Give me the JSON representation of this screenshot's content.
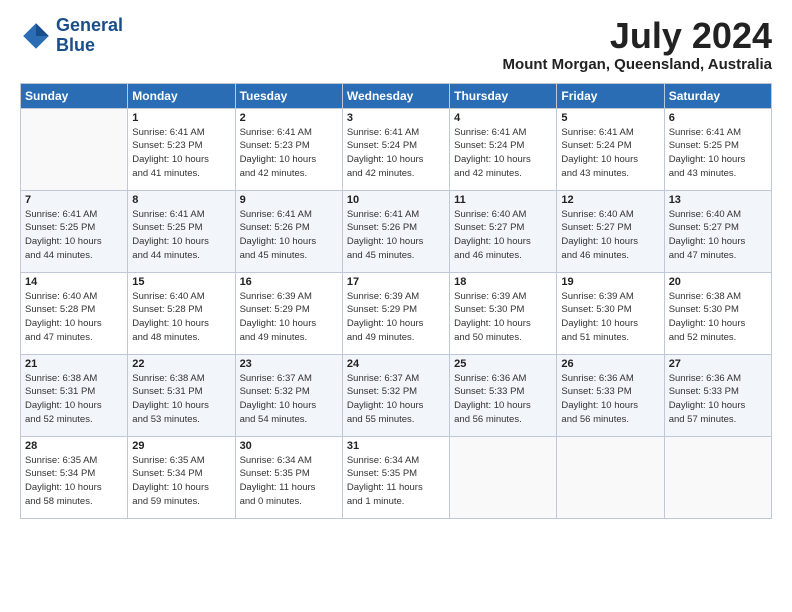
{
  "logo": {
    "line1": "General",
    "line2": "Blue"
  },
  "header": {
    "month_year": "July 2024",
    "location": "Mount Morgan, Queensland, Australia"
  },
  "days_of_week": [
    "Sunday",
    "Monday",
    "Tuesday",
    "Wednesday",
    "Thursday",
    "Friday",
    "Saturday"
  ],
  "weeks": [
    [
      {
        "day": "",
        "info": ""
      },
      {
        "day": "1",
        "info": "Sunrise: 6:41 AM\nSunset: 5:23 PM\nDaylight: 10 hours\nand 41 minutes."
      },
      {
        "day": "2",
        "info": "Sunrise: 6:41 AM\nSunset: 5:23 PM\nDaylight: 10 hours\nand 42 minutes."
      },
      {
        "day": "3",
        "info": "Sunrise: 6:41 AM\nSunset: 5:24 PM\nDaylight: 10 hours\nand 42 minutes."
      },
      {
        "day": "4",
        "info": "Sunrise: 6:41 AM\nSunset: 5:24 PM\nDaylight: 10 hours\nand 42 minutes."
      },
      {
        "day": "5",
        "info": "Sunrise: 6:41 AM\nSunset: 5:24 PM\nDaylight: 10 hours\nand 43 minutes."
      },
      {
        "day": "6",
        "info": "Sunrise: 6:41 AM\nSunset: 5:25 PM\nDaylight: 10 hours\nand 43 minutes."
      }
    ],
    [
      {
        "day": "7",
        "info": ""
      },
      {
        "day": "8",
        "info": "Sunrise: 6:41 AM\nSunset: 5:25 PM\nDaylight: 10 hours\nand 44 minutes."
      },
      {
        "day": "9",
        "info": "Sunrise: 6:41 AM\nSunset: 5:26 PM\nDaylight: 10 hours\nand 45 minutes."
      },
      {
        "day": "10",
        "info": "Sunrise: 6:41 AM\nSunset: 5:26 PM\nDaylight: 10 hours\nand 45 minutes."
      },
      {
        "day": "11",
        "info": "Sunrise: 6:40 AM\nSunset: 5:27 PM\nDaylight: 10 hours\nand 46 minutes."
      },
      {
        "day": "12",
        "info": "Sunrise: 6:40 AM\nSunset: 5:27 PM\nDaylight: 10 hours\nand 46 minutes."
      },
      {
        "day": "13",
        "info": "Sunrise: 6:40 AM\nSunset: 5:27 PM\nDaylight: 10 hours\nand 47 minutes."
      }
    ],
    [
      {
        "day": "14",
        "info": ""
      },
      {
        "day": "15",
        "info": "Sunrise: 6:40 AM\nSunset: 5:28 PM\nDaylight: 10 hours\nand 48 minutes."
      },
      {
        "day": "16",
        "info": "Sunrise: 6:39 AM\nSunset: 5:29 PM\nDaylight: 10 hours\nand 49 minutes."
      },
      {
        "day": "17",
        "info": "Sunrise: 6:39 AM\nSunset: 5:29 PM\nDaylight: 10 hours\nand 49 minutes."
      },
      {
        "day": "18",
        "info": "Sunrise: 6:39 AM\nSunset: 5:30 PM\nDaylight: 10 hours\nand 50 minutes."
      },
      {
        "day": "19",
        "info": "Sunrise: 6:39 AM\nSunset: 5:30 PM\nDaylight: 10 hours\nand 51 minutes."
      },
      {
        "day": "20",
        "info": "Sunrise: 6:38 AM\nSunset: 5:30 PM\nDaylight: 10 hours\nand 52 minutes."
      }
    ],
    [
      {
        "day": "21",
        "info": ""
      },
      {
        "day": "22",
        "info": "Sunrise: 6:38 AM\nSunset: 5:31 PM\nDaylight: 10 hours\nand 53 minutes."
      },
      {
        "day": "23",
        "info": "Sunrise: 6:37 AM\nSunset: 5:32 PM\nDaylight: 10 hours\nand 54 minutes."
      },
      {
        "day": "24",
        "info": "Sunrise: 6:37 AM\nSunset: 5:32 PM\nDaylight: 10 hours\nand 55 minutes."
      },
      {
        "day": "25",
        "info": "Sunrise: 6:36 AM\nSunset: 5:33 PM\nDaylight: 10 hours\nand 56 minutes."
      },
      {
        "day": "26",
        "info": "Sunrise: 6:36 AM\nSunset: 5:33 PM\nDaylight: 10 hours\nand 56 minutes."
      },
      {
        "day": "27",
        "info": "Sunrise: 6:36 AM\nSunset: 5:33 PM\nDaylight: 10 hours\nand 57 minutes."
      }
    ],
    [
      {
        "day": "28",
        "info": ""
      },
      {
        "day": "29",
        "info": "Sunrise: 6:35 AM\nSunset: 5:34 PM\nDaylight: 10 hours\nand 59 minutes."
      },
      {
        "day": "30",
        "info": "Sunrise: 6:34 AM\nSunset: 5:35 PM\nDaylight: 11 hours\nand 0 minutes."
      },
      {
        "day": "31",
        "info": "Sunrise: 6:34 AM\nSunset: 5:35 PM\nDaylight: 11 hours\nand 1 minute."
      },
      {
        "day": "",
        "info": ""
      },
      {
        "day": "",
        "info": ""
      },
      {
        "day": "",
        "info": ""
      }
    ]
  ],
  "week1_sun_info": "",
  "week2_sun_info": "Sunrise: 6:41 AM\nSunset: 5:25 PM\nDaylight: 10 hours\nand 44 minutes.",
  "week3_sun_info": "Sunrise: 6:40 AM\nSunset: 5:28 PM\nDaylight: 10 hours\nand 47 minutes.",
  "week4_sun_info": "Sunrise: 6:38 AM\nSunset: 5:31 PM\nDaylight: 10 hours\nand 52 minutes.",
  "week5_sun_info": "Sunrise: 6:35 AM\nSunset: 5:34 PM\nDaylight: 10 hours\nand 58 minutes."
}
